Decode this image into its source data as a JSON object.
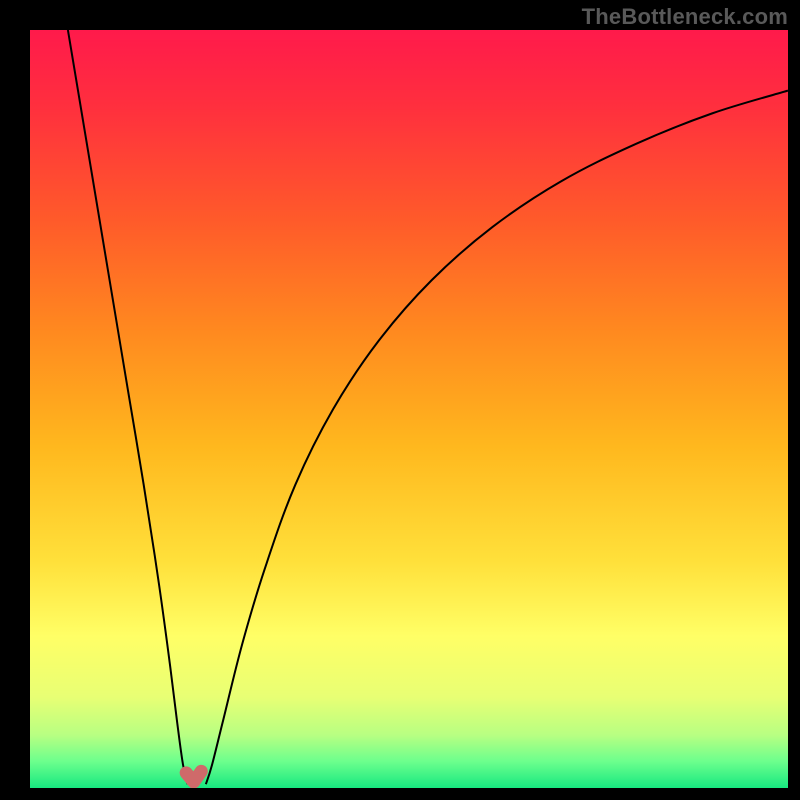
{
  "watermark": "TheBottleneck.com",
  "frame": {
    "outer_w": 800,
    "outer_h": 800,
    "border_left": 30,
    "border_right": 12,
    "border_top": 30,
    "border_bottom": 12
  },
  "colors": {
    "frame": "#000000",
    "curve_stroke": "#000000",
    "marker_fill": "#cf6a6a",
    "marker_stroke": "#cf6a6a"
  },
  "gradient_stops": [
    {
      "offset": 0.0,
      "color": "#ff1a4b"
    },
    {
      "offset": 0.1,
      "color": "#ff2f3e"
    },
    {
      "offset": 0.25,
      "color": "#ff5a2a"
    },
    {
      "offset": 0.4,
      "color": "#ff8a1f"
    },
    {
      "offset": 0.55,
      "color": "#ffb81e"
    },
    {
      "offset": 0.7,
      "color": "#ffe03a"
    },
    {
      "offset": 0.8,
      "color": "#ffff66"
    },
    {
      "offset": 0.88,
      "color": "#e8ff74"
    },
    {
      "offset": 0.93,
      "color": "#b8ff82"
    },
    {
      "offset": 0.965,
      "color": "#6cff8d"
    },
    {
      "offset": 1.0,
      "color": "#17e880"
    }
  ],
  "chart_data": {
    "type": "line",
    "title": "",
    "xlabel": "",
    "ylabel": "",
    "xlim": [
      0,
      100
    ],
    "ylim": [
      0,
      100
    ],
    "series": [
      {
        "name": "left-branch",
        "x": [
          5,
          7,
          9,
          11,
          13,
          15,
          17,
          18.5,
          19.5,
          20.2,
          20.8
        ],
        "y": [
          100,
          88,
          76,
          64,
          52,
          40,
          27,
          16,
          8,
          3,
          0.5
        ]
      },
      {
        "name": "right-branch",
        "x": [
          23.2,
          24,
          25.5,
          28,
          31,
          35,
          40,
          46,
          53,
          61,
          70,
          80,
          90,
          100
        ],
        "y": [
          0.5,
          3,
          9,
          19,
          29,
          40,
          50,
          59,
          67,
          74,
          80,
          85,
          89,
          92
        ]
      }
    ],
    "markers": {
      "name": "bottom-markers",
      "x": [
        20.6,
        21.6,
        22.6
      ],
      "y": [
        2.0,
        0.8,
        2.2
      ]
    },
    "notch": {
      "center_x": 22,
      "y": 0
    }
  }
}
